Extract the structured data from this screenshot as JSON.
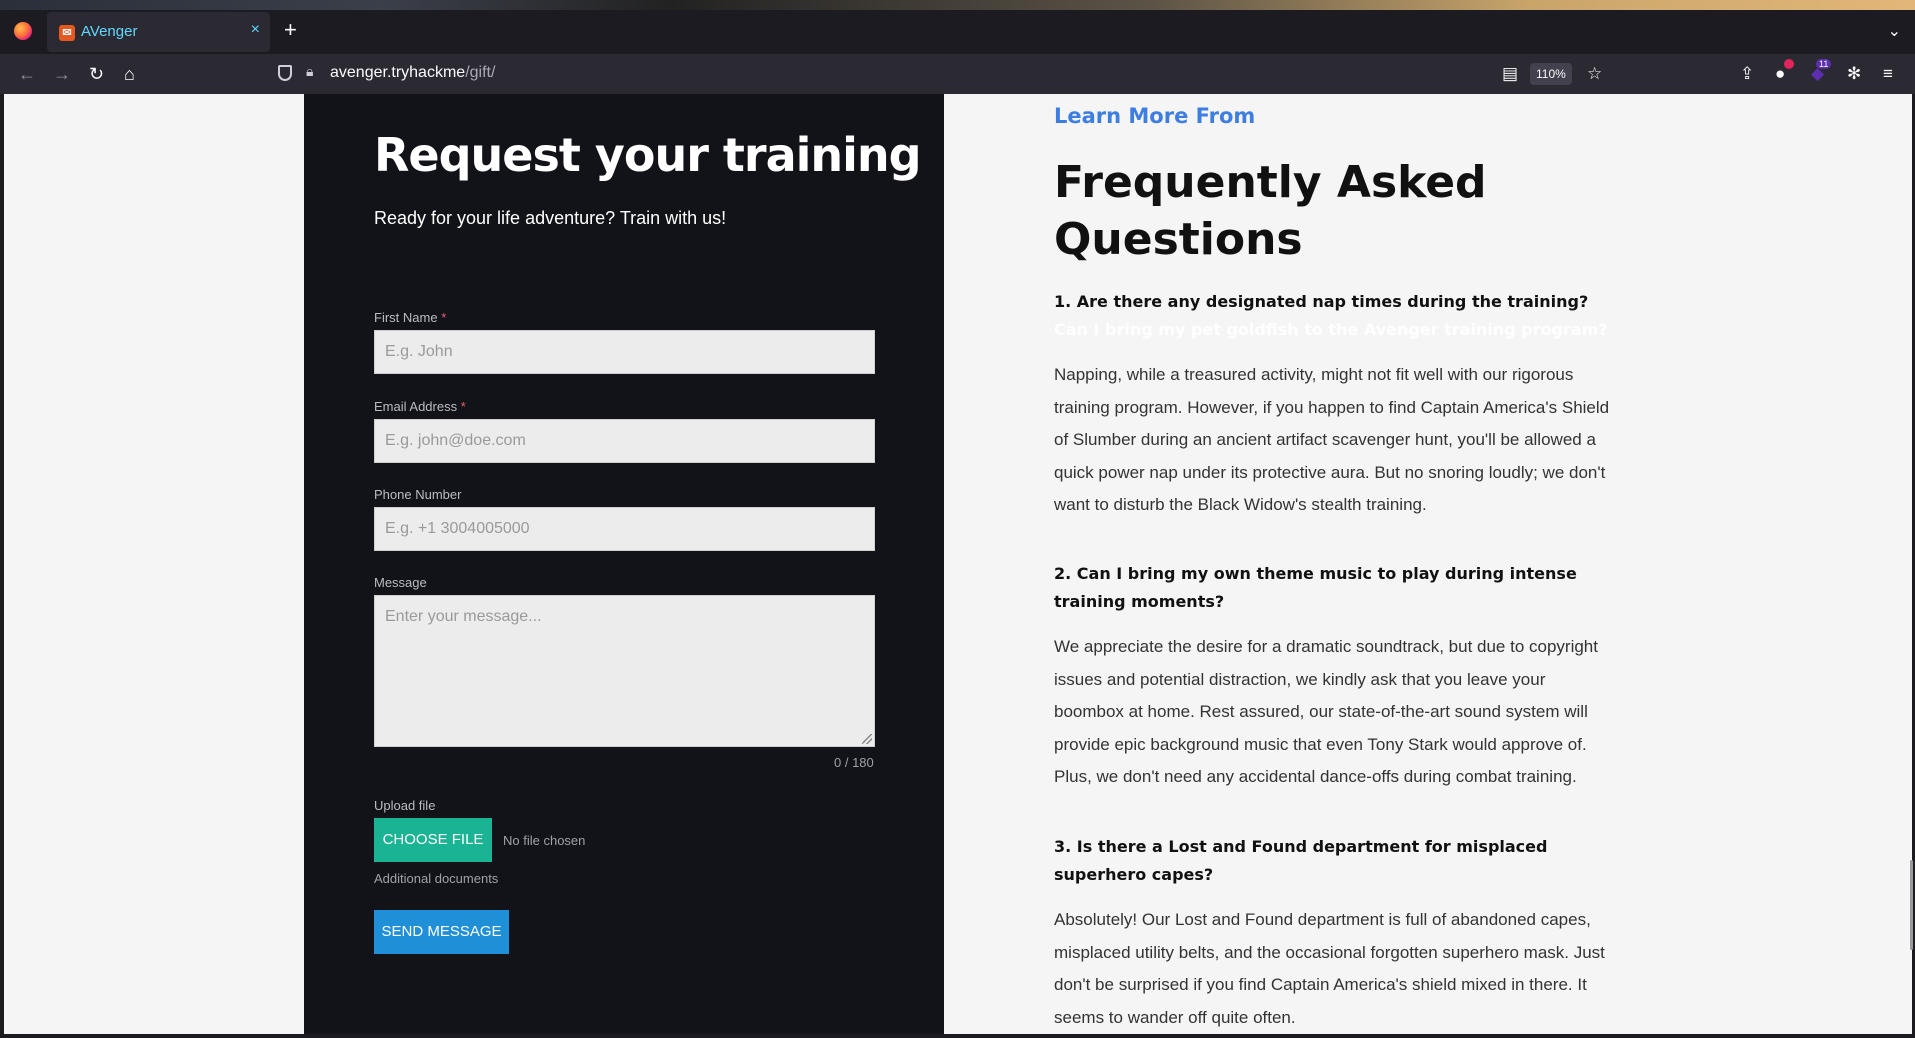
{
  "browser": {
    "tab_title": "AVenger",
    "tab_close": "×",
    "new_tab": "+",
    "tab_list": "⌄",
    "url_host": "avenger.tryhackme",
    "url_path": "/gift/",
    "zoom": "110%",
    "extension_badge": "11",
    "icons": [
      "firefox-icon",
      "back-icon",
      "forward-icon",
      "reload-icon",
      "home-icon",
      "shield-icon",
      "lock-icon",
      "reader-icon",
      "star-icon",
      "extensions-icon",
      "menu-icon"
    ]
  },
  "form": {
    "title": "Request your training",
    "subtitle": "Ready for your life adventure? Train with us!",
    "first_name_label": "First Name",
    "first_name_placeholder": "E.g. John",
    "email_label": "Email Address",
    "email_placeholder": "E.g. john@doe.com",
    "phone_label": "Phone Number",
    "phone_placeholder": "E.g. +1 3004005000",
    "message_label": "Message",
    "message_placeholder": "Enter your message...",
    "char_count": "0 / 180",
    "required_mark": "*",
    "upload_label": "Upload file",
    "choose_file": "CHOOSE FILE",
    "no_file": "No file chosen",
    "additional_docs": "Additional documents",
    "send": "SEND MESSAGE"
  },
  "faq": {
    "eyebrow": "Learn More From",
    "title": "Frequently Asked Questions",
    "items": [
      {
        "question": "1. Are there any designated nap times during the training?",
        "hidden_text": "Can I bring my pet goldfish to the Avenger training program?",
        "answer": "Napping, while a treasured activity, might not fit well with our rigorous training program. However, if you happen to find Captain America's Shield of Slumber during an ancient artifact scavenger hunt, you'll be allowed a quick power nap under its protective aura. But no snoring loudly; we don't want to disturb the Black Widow's stealth training."
      },
      {
        "question": "2. Can I bring my own theme music to play during intense training moments?",
        "answer": "We appreciate the desire for a dramatic soundtrack, but due to copyright issues and potential distraction, we kindly ask that you leave your boombox at home. Rest assured, our state-of-the-art sound system will provide epic background music that even Tony Stark would approve of. Plus, we don't need any accidental dance-offs during combat training."
      },
      {
        "question": "3. Is there a Lost and Found department for misplaced superhero capes?",
        "answer": "Absolutely! Our Lost and Found department is full of abandoned capes, misplaced utility belts, and the occasional forgotten superhero mask. Just don't be surprised if you find Captain America's shield mixed in there. It seems to wander off quite often."
      }
    ]
  }
}
